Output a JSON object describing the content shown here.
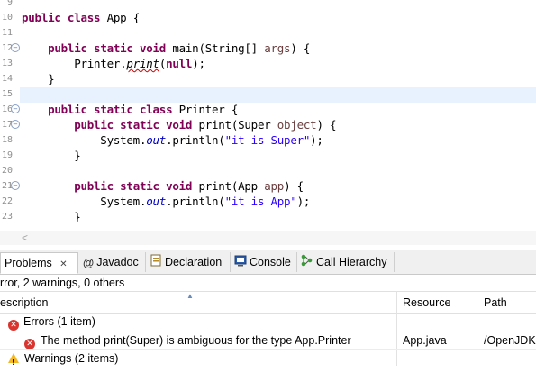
{
  "editor": {
    "lines": [
      {
        "num": "9",
        "tokens": []
      },
      {
        "num": "10",
        "tokens": [
          {
            "t": "public class",
            "c": "kw"
          },
          {
            "t": " App {"
          }
        ]
      },
      {
        "num": "11",
        "tokens": []
      },
      {
        "num": "12",
        "fold": true,
        "tokens": [
          {
            "t": "    "
          },
          {
            "t": "public static void",
            "c": "kw"
          },
          {
            "t": " main(String[] "
          },
          {
            "t": "args",
            "c": "param"
          },
          {
            "t": ") {"
          }
        ]
      },
      {
        "num": "13",
        "tokens": [
          {
            "t": "        Printer."
          },
          {
            "t": "print",
            "c": "mth"
          },
          {
            "t": "("
          },
          {
            "t": "null",
            "c": "kw"
          },
          {
            "t": ");"
          }
        ]
      },
      {
        "num": "14",
        "tokens": [
          {
            "t": "    }"
          }
        ]
      },
      {
        "num": "15",
        "tokens": []
      },
      {
        "num": "16",
        "fold": true,
        "tokens": [
          {
            "t": "    "
          },
          {
            "t": "public static class",
            "c": "kw"
          },
          {
            "t": " Printer {"
          }
        ]
      },
      {
        "num": "17",
        "fold": true,
        "tokens": [
          {
            "t": "        "
          },
          {
            "t": "public static void",
            "c": "kw"
          },
          {
            "t": " print(Super "
          },
          {
            "t": "object",
            "c": "param"
          },
          {
            "t": ") {"
          }
        ]
      },
      {
        "num": "18",
        "tokens": [
          {
            "t": "            System."
          },
          {
            "t": "out",
            "c": "fld"
          },
          {
            "t": ".println("
          },
          {
            "t": "\"it is Super\"",
            "c": "str"
          },
          {
            "t": ");"
          }
        ]
      },
      {
        "num": "19",
        "tokens": [
          {
            "t": "        }"
          }
        ]
      },
      {
        "num": "20",
        "tokens": []
      },
      {
        "num": "21",
        "fold": true,
        "tokens": [
          {
            "t": "        "
          },
          {
            "t": "public static void",
            "c": "kw"
          },
          {
            "t": " print(App "
          },
          {
            "t": "app",
            "c": "param"
          },
          {
            "t": ") {"
          }
        ]
      },
      {
        "num": "22",
        "tokens": [
          {
            "t": "            System."
          },
          {
            "t": "out",
            "c": "fld"
          },
          {
            "t": ".println("
          },
          {
            "t": "\"it is App\"",
            "c": "str"
          },
          {
            "t": ");"
          }
        ]
      },
      {
        "num": "23",
        "tokens": [
          {
            "t": "        }"
          }
        ]
      }
    ],
    "hscroll_arrow": "<"
  },
  "tabs": [
    {
      "label": "Problems",
      "icon": "problems-icon",
      "close": "✕"
    },
    {
      "label": "Javadoc",
      "icon": "javadoc-icon"
    },
    {
      "label": "Declaration",
      "icon": "declaration-icon"
    },
    {
      "label": "Console",
      "icon": "console-icon"
    },
    {
      "label": "Call Hierarchy",
      "icon": "call-hierarchy-icon"
    }
  ],
  "problems": {
    "summary": "rror, 2 warnings, 0 others",
    "columns": {
      "description": "escription",
      "resource": "Resource",
      "path": "Path"
    },
    "groups": [
      {
        "label": "Errors (1 item)",
        "type": "error"
      },
      {
        "label": "The method print(Super) is ambiguous for the type App.Printer",
        "type": "error",
        "resource": "App.java",
        "path": "/OpenJDK"
      },
      {
        "label": "Warnings (2 items)",
        "type": "warning"
      }
    ]
  },
  "colors": {
    "keyword": "#7f0055",
    "string": "#2a00ff",
    "field": "#0000c0",
    "current_line": "#e8f2fe",
    "error": "#d9352e",
    "warning": "#f3b823"
  }
}
